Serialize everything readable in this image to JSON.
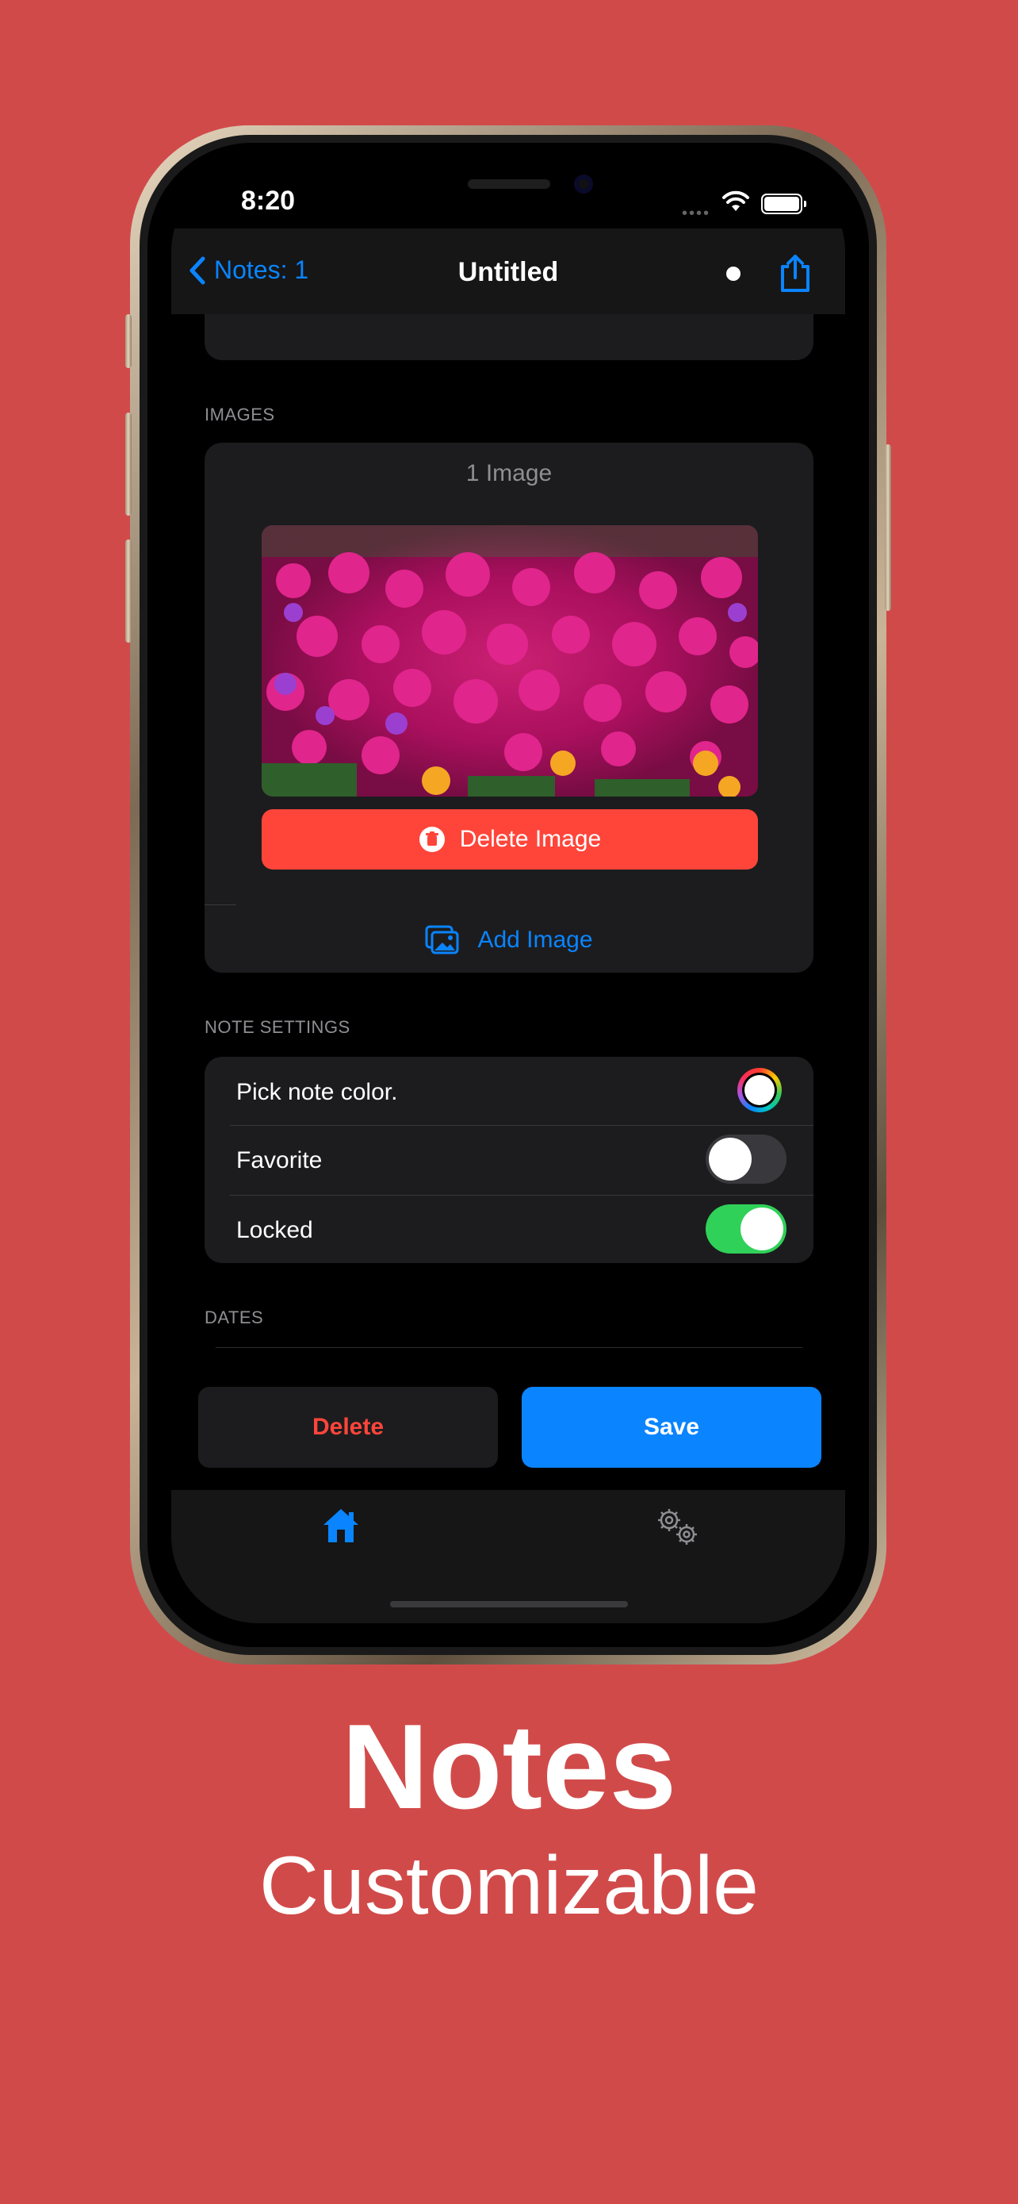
{
  "status_bar": {
    "time": "8:20"
  },
  "nav": {
    "back_label": "Notes: 1",
    "title": "Untitled"
  },
  "images_section": {
    "header": "IMAGES",
    "count_label": "1 Image",
    "delete_label": "Delete Image",
    "add_label": "Add Image"
  },
  "note_settings": {
    "header": "NOTE SETTINGS",
    "rows": [
      {
        "label": "Pick note color.",
        "control": "color-well"
      },
      {
        "label": "Favorite",
        "control": "toggle",
        "on": false
      },
      {
        "label": "Locked",
        "control": "toggle",
        "on": true
      }
    ]
  },
  "dates_section": {
    "header": "DATES"
  },
  "actions": {
    "delete_label": "Delete",
    "save_label": "Save"
  },
  "tabbar": {
    "items": [
      {
        "icon": "home-icon",
        "selected": true
      },
      {
        "icon": "gears-icon",
        "selected": false
      }
    ]
  },
  "promo": {
    "title": "Notes",
    "subtitle": "Customizable"
  },
  "colors": {
    "background": "#d14a4a",
    "accent": "#0a84ff",
    "destructive": "#ff453a",
    "toggle_on": "#30d158",
    "card": "#1c1c1e"
  }
}
